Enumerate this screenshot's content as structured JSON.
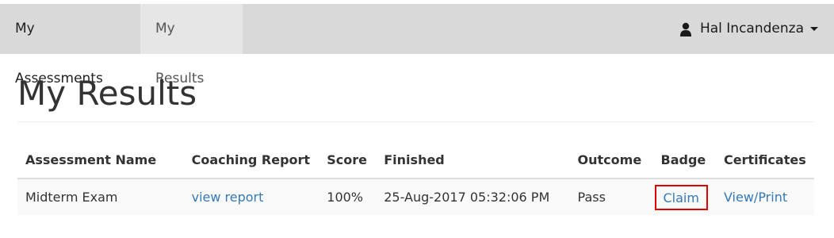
{
  "nav": {
    "items": [
      {
        "label": "My Assessments"
      },
      {
        "label": "My Results"
      }
    ],
    "user": {
      "name": "Hal Incandenza",
      "icon": "user-icon"
    }
  },
  "page": {
    "title": "My Results"
  },
  "table": {
    "headers": [
      "Assessment Name",
      "Coaching Report",
      "Score",
      "Finished",
      "Outcome",
      "Badge",
      "Certificates"
    ],
    "rows": [
      {
        "assessment_name": "Midterm Exam",
        "coaching_report": "view report",
        "score": "100%",
        "finished": "25-Aug-2017 05:32:06 PM",
        "outcome": "Pass",
        "badge": "Claim",
        "certificates": "View/Print"
      }
    ]
  },
  "colors": {
    "navbar_bg": "#d9d9d9",
    "active_tab_bg": "#e6e6e6",
    "link": "#337ab7",
    "highlight_box": "#e00000"
  }
}
